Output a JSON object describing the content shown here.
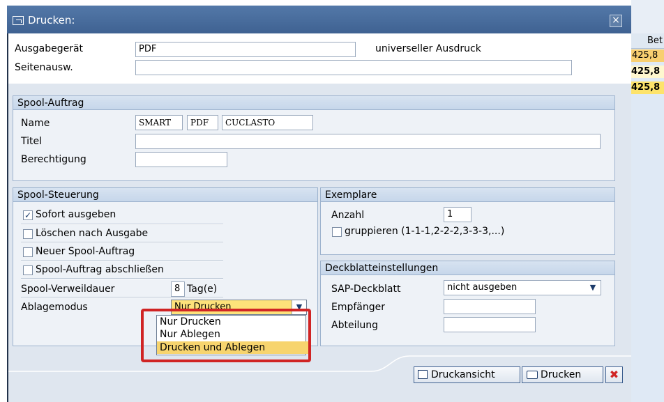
{
  "background": {
    "header_label": "Bet",
    "values": [
      "425,8",
      "425,8",
      "425,8"
    ]
  },
  "dialog": {
    "title": "Drucken:",
    "close_glyph": "×"
  },
  "top": {
    "ausgabegeraet_label": "Ausgabegerät",
    "ausgabegeraet_value": "PDF",
    "ausgabegeraet_desc": "universeller Ausdruck",
    "seitenausw_label": "Seitenausw.",
    "seitenausw_value": ""
  },
  "spool_auftrag": {
    "header": "Spool-Auftrag",
    "name_label": "Name",
    "name_parts": [
      "SMART",
      "PDF",
      "CUCLASTO"
    ],
    "titel_label": "Titel",
    "titel_value": "",
    "berechtigung_label": "Berechtigung",
    "berechtigung_value": ""
  },
  "spool_steuerung": {
    "header": "Spool-Steuerung",
    "checkboxes": [
      {
        "label": "Sofort ausgeben",
        "checked": true
      },
      {
        "label": "Löschen nach Ausgabe",
        "checked": false
      },
      {
        "label": "Neuer Spool-Auftrag",
        "checked": false
      },
      {
        "label": "Spool-Auftrag abschließen",
        "checked": false
      }
    ],
    "verweildauer_label": "Spool-Verweildauer",
    "verweildauer_value": "8",
    "verweildauer_unit": "Tag(e)",
    "ablagemodus_label": "Ablagemodus",
    "ablagemodus_value": "Nur Drucken",
    "ablagemodus_options": [
      "Nur Drucken",
      "Nur Ablegen",
      "Drucken und Ablegen"
    ]
  },
  "exemplare": {
    "header": "Exemplare",
    "anzahl_label": "Anzahl",
    "anzahl_value": "1",
    "gruppieren_label": "gruppieren (1-1-1,2-2-2,3-3-3,...)",
    "gruppieren_checked": false
  },
  "deckblatt": {
    "header": "Deckblatteinstellungen",
    "sap_deckblatt_label": "SAP-Deckblatt",
    "sap_deckblatt_value": "nicht ausgeben",
    "empfaenger_label": "Empfänger",
    "empfaenger_value": "",
    "abteilung_label": "Abteilung",
    "abteilung_value": ""
  },
  "footer": {
    "druckansicht_label": "Druckansicht",
    "drucken_label": "Drucken"
  },
  "colors": {
    "highlight_red": "#d02424",
    "title_blue": "#4a6d9c",
    "selected_option": "#f7d46e"
  }
}
